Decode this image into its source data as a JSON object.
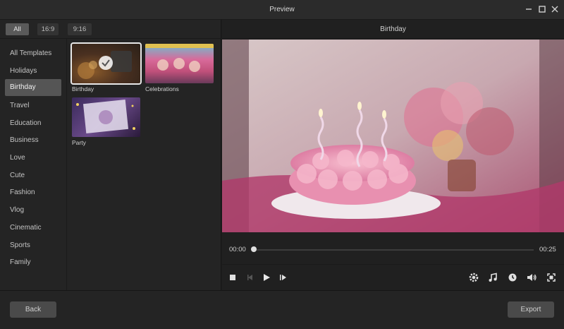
{
  "window": {
    "title": "Preview"
  },
  "aspect_filters": [
    {
      "label": "All",
      "active": true
    },
    {
      "label": "16:9",
      "active": false
    },
    {
      "label": "9:16",
      "active": false
    }
  ],
  "categories": [
    {
      "label": "All Templates"
    },
    {
      "label": "Holidays"
    },
    {
      "label": "Birthday",
      "active": true
    },
    {
      "label": "Travel"
    },
    {
      "label": "Education"
    },
    {
      "label": "Business"
    },
    {
      "label": "Love"
    },
    {
      "label": "Cute"
    },
    {
      "label": "Fashion"
    },
    {
      "label": "Vlog"
    },
    {
      "label": "Cinematic"
    },
    {
      "label": "Sports"
    },
    {
      "label": "Family"
    }
  ],
  "templates": [
    {
      "label": "Birthday",
      "selected": true
    },
    {
      "label": "Celebrations",
      "selected": false
    },
    {
      "label": "Party",
      "selected": false
    }
  ],
  "preview": {
    "title": "Birthday",
    "current_time": "00:00",
    "total_time": "00:25"
  },
  "footer": {
    "back_label": "Back",
    "export_label": "Export"
  }
}
